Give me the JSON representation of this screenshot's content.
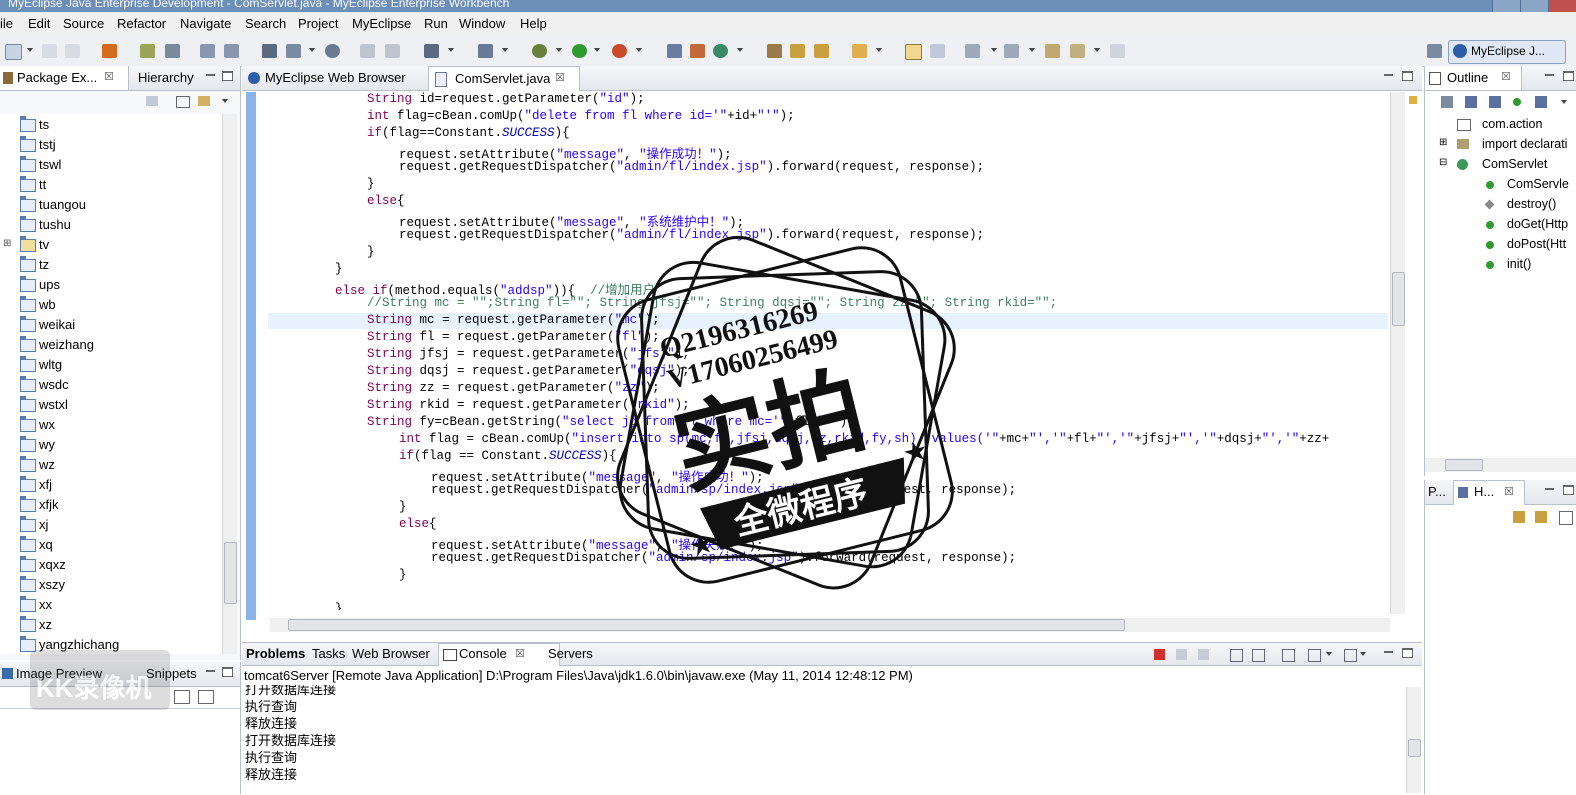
{
  "window": {
    "title": "MyEclipse Java Enterprise Development - ComServlet.java - MyEclipse Enterprise Workbench"
  },
  "menu": [
    "File",
    "Edit",
    "Source",
    "Refactor",
    "Navigate",
    "Search",
    "Project",
    "MyEclipse",
    "Run",
    "Window",
    "Help"
  ],
  "menu_visible": [
    "ile",
    "Edit",
    "Source",
    "Refactor",
    "Navigate",
    "Search",
    "Project",
    "MyEclipse",
    "Run",
    "Window",
    "Help"
  ],
  "perspective": {
    "label": "MyEclipse J..."
  },
  "left_tabs": {
    "package_explorer": "Package Ex...",
    "hierarchy": "Hierarchy"
  },
  "tree_items": [
    "ts",
    "tstj",
    "tswl",
    "tt",
    "tuangou",
    "tushu",
    "tv",
    "tz",
    "ups",
    "wb",
    "weikai",
    "weizhang",
    "wltg",
    "wsdc",
    "wstxl",
    "wx",
    "wy",
    "wz",
    "xfj",
    "xfjk",
    "xj",
    "xq",
    "xqxz",
    "xszy",
    "xx",
    "xz",
    "yangzhichang"
  ],
  "left_bottom_tabs": {
    "image_preview": "Image Preview",
    "snippets": "Snippets"
  },
  "editor_tabs": [
    {
      "label": "MyEclipse Web Browser",
      "active": false
    },
    {
      "label": "ComServlet.java",
      "active": true
    }
  ],
  "code_lines": [
    "String id=request.getParameter(\"id\");",
    "int flag=cBean.comUp(\"delete from fl where id='\"+id+\"'\");",
    "if(flag==Constant.SUCCESS){",
    "request.setAttribute(\"message\", \"操作成功！\");",
    "request.getRequestDispatcher(\"admin/fl/index.jsp\").forward(request, response);",
    "}",
    "else{",
    "request.setAttribute(\"message\", \"系统维护中！\");",
    "request.getRequestDispatcher(\"admin/fl/index.jsp\").forward(request, response);",
    "}",
    "}",
    "else if(method.equals(\"addsp\")){  //增加用户",
    "//String mc = \"\";String fl=\"\"; String jfsj=\"\"; String dqsj=\"\"; String zz=\"\"; String rkid=\"\";",
    "String mc = request.getParameter(\"mc\");",
    "String fl = request.getParameter(\"fl\");",
    "String jfsj = request.getParameter(\"jfsj\");",
    "String dqsj = request.getParameter(\"dqsj\");",
    "String zz = request.getParameter(\"zz\");",
    "String rkid = request.getParameter(\"rkid\");",
    "String fy=cBean.getString(\"select jg from fl where mc='\"+fl+\"'\");",
    "int flag = cBean.comUp(\"insert into sp(mc,fl,jfsj,dqsj,zz,rkid,fy,sh)  values('\"+mc+\"','\"+fl+\"','\"+jfsj+\"','\"+dqsj+\"','\"+zz+",
    "if(flag == Constant.SUCCESS){",
    "request.setAttribute(\"message\", \"操作成功！\");",
    "request.getRequestDispatcher(\"admin/sp/index.jsp\").forward(request, response);",
    "}",
    "else{",
    "request.setAttribute(\"message\", \"操作失败！\");",
    "request.getRequestDispatcher(\"admin/sp/index.jsp\").forward(request, response);",
    "}",
    "",
    "}"
  ],
  "console_tabs": [
    "Problems",
    "Tasks",
    "Web Browser",
    "Console",
    "Servers"
  ],
  "console": {
    "header": "tomcat6Server [Remote Java Application] D:\\Program Files\\Java\\jdk1.6.0\\bin\\javaw.exe (May 11, 2014 12:48:12 PM)",
    "lines": [
      "打开数据库连接",
      "执行查询",
      "释放连接",
      "打开数据库连接",
      "执行查询",
      "释放连接"
    ]
  },
  "outline": {
    "tab": "Outline",
    "items": [
      "com.action",
      "import declarati",
      "ComServlet",
      "ComServle",
      "destroy()",
      "doGet(Http",
      "doPost(Htt",
      "init()"
    ]
  },
  "right_bottom_tabs": [
    "P...",
    "H..."
  ],
  "stamp": {
    "qq": "Q2196316269",
    "vx": "V17060256499",
    "big": "实拍",
    "banner": "全微程序"
  },
  "watermark": "KK录像机",
  "colors": {
    "keyword": "#7f0055",
    "string": "#2a00ff",
    "comment": "#3f7f5f",
    "field": "#0000c0",
    "accent": "#2d5ea8"
  }
}
